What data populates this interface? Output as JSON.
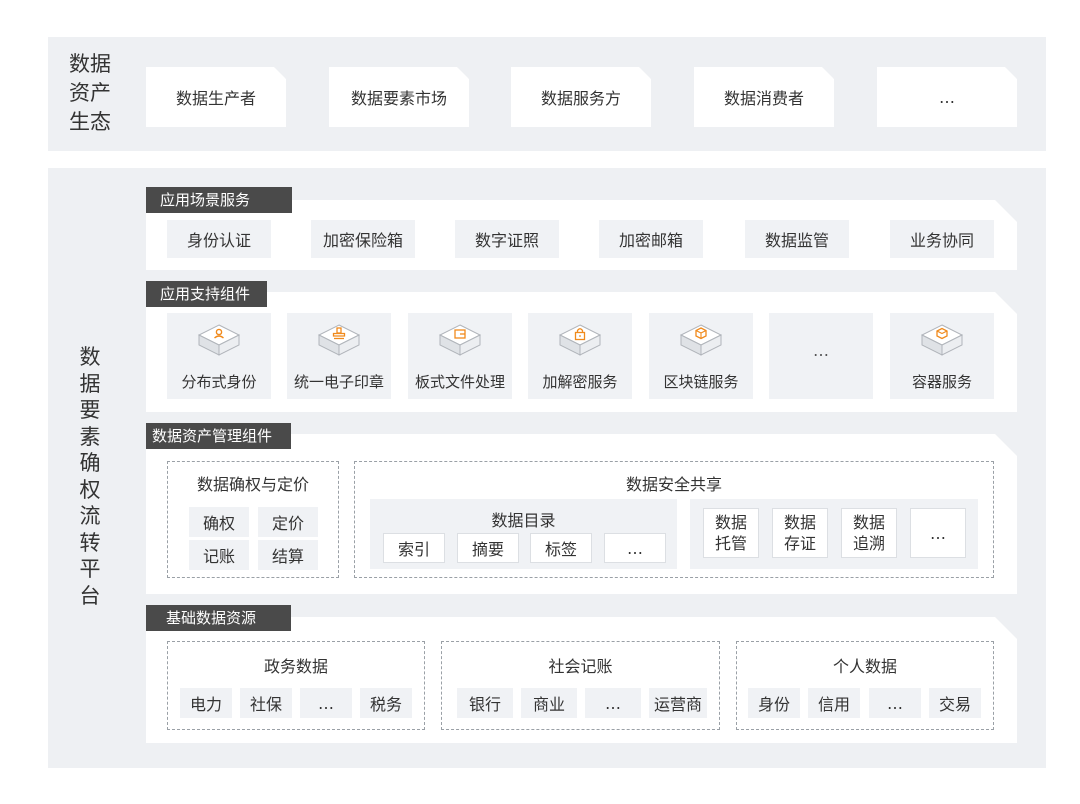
{
  "ecosystem": {
    "title": "数据\n资产\n生态",
    "items": [
      "数据生产者",
      "数据要素市场",
      "数据服务方",
      "数据消费者",
      "…"
    ]
  },
  "platform": {
    "title": "数\n据\n要\n素\n确\n权\n流\n转\n平\n台",
    "app_services": {
      "title": "应用场景服务",
      "items": [
        "身份认证",
        "加密保险箱",
        "数字证照",
        "加密邮箱",
        "数据监管",
        "业务协同"
      ]
    },
    "app_components": {
      "title": "应用支持组件",
      "items": [
        {
          "label": "分布式身份",
          "icon": "person-icon"
        },
        {
          "label": "统一电子印章",
          "icon": "stamp-icon"
        },
        {
          "label": "板式文件处理",
          "icon": "file-icon"
        },
        {
          "label": "加解密服务",
          "icon": "lock-icon"
        },
        {
          "label": "区块链服务",
          "icon": "blockchain-icon"
        },
        {
          "label": "…",
          "icon": ""
        },
        {
          "label": "容器服务",
          "icon": "container-icon"
        }
      ]
    },
    "asset_mgmt": {
      "title": "数据资产管理组件",
      "rights": {
        "title": "数据确权与定价",
        "items": [
          "确权",
          "定价",
          "记账",
          "结算"
        ]
      },
      "sharing": {
        "title": "数据安全共享",
        "catalog": {
          "title": "数据目录",
          "items": [
            "索引",
            "摘要",
            "标签",
            "…"
          ]
        },
        "items": [
          "数据\n托管",
          "数据\n存证",
          "数据\n追溯",
          "…"
        ]
      }
    },
    "base_data": {
      "title": "基础数据资源",
      "groups": [
        {
          "title": "政务数据",
          "items": [
            "电力",
            "社保",
            "…",
            "税务"
          ]
        },
        {
          "title": "社会记账",
          "items": [
            "银行",
            "商业",
            "…",
            "运营商"
          ]
        },
        {
          "title": "个人数据",
          "items": [
            "身份",
            "信用",
            "…",
            "交易"
          ]
        }
      ]
    }
  },
  "colors": {
    "accent": "#f08a1c",
    "tab_bg": "#4a4a4a",
    "band_bg": "#eef0f3",
    "chip_bg": "#f0f2f5"
  }
}
